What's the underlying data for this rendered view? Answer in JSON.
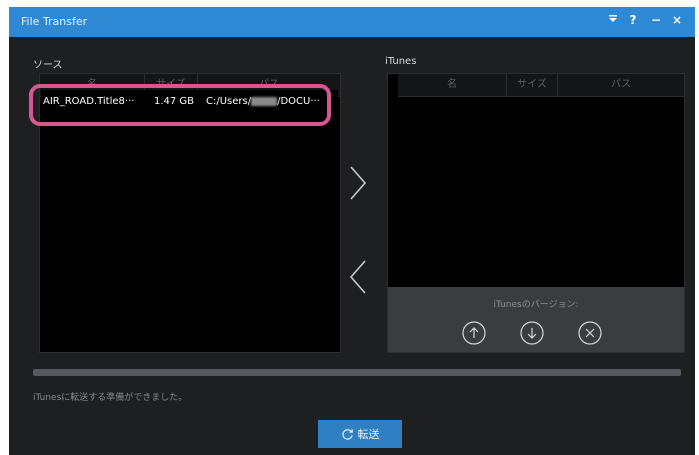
{
  "window": {
    "title": "File Transfer"
  },
  "titlebar_controls": [
    "menu-icon",
    "help-icon",
    "minimize-icon",
    "close-icon"
  ],
  "source": {
    "label": "ソース",
    "columns": [
      "名",
      "サイズ",
      "パス"
    ],
    "rows": [
      {
        "name": "AIR_ROAD.Title8···",
        "size": "1.47 GB",
        "path_prefix": "C:/Users/",
        "path_suffix": "/DOCU···"
      }
    ]
  },
  "itunes": {
    "label": "iTunes",
    "columns": [
      "名",
      "サイズ",
      "パス"
    ],
    "version_label": "iTunesのバージョン:"
  },
  "status_text": "iTunesに転送する準備ができました。",
  "transfer_button": {
    "label": "転送",
    "icon": "refresh-icon"
  },
  "colors": {
    "titlebar": "#2e88d3",
    "background": "#1d1f21",
    "highlight": "#d9578f",
    "button": "#2f7fc2"
  }
}
